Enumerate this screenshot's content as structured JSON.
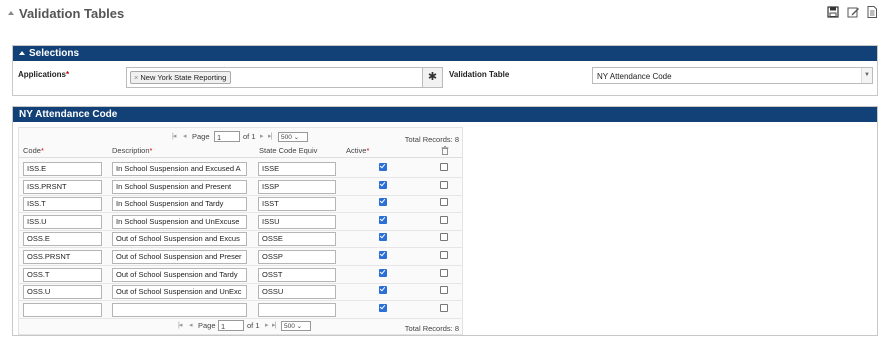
{
  "page": {
    "title": "Validation Tables",
    "icons": [
      "save-icon",
      "edit-icon",
      "document-icon"
    ]
  },
  "selections": {
    "title": "Selections",
    "applications_label": "Applications",
    "applications_value": "New York State Reporting",
    "validation_table_label": "Validation Table",
    "validation_table_value": "NY Attendance Code",
    "required_mark": "*"
  },
  "table_panel": {
    "title": "NY Attendance Code",
    "pager_top": {
      "page_label": "Page",
      "page_value": "1",
      "of_label": "of 1",
      "per_page": "500",
      "total": "Total Records: 8"
    },
    "pager_bottom": {
      "page_label": "Page",
      "page_value": "1",
      "of_label": "of 1",
      "per_page": "500",
      "total": "Total Records: 8"
    },
    "columns": [
      "Code",
      "Description",
      "State Code Equiv",
      "Active"
    ],
    "rows": [
      {
        "code": "ISS.E",
        "description": "In School Suspension and Excused A",
        "state": "ISSE",
        "active": true
      },
      {
        "code": "ISS.PRSNT",
        "description": "In School Suspension and Present",
        "state": "ISSP",
        "active": true
      },
      {
        "code": "ISS.T",
        "description": "In School Suspension and Tardy",
        "state": "ISST",
        "active": true
      },
      {
        "code": "ISS.U",
        "description": "In School Suspension and UnExcuse",
        "state": "ISSU",
        "active": true
      },
      {
        "code": "OSS.E",
        "description": "Out of School Suspension and Excus",
        "state": "OSSE",
        "active": true
      },
      {
        "code": "OSS.PRSNT",
        "description": "Out of School Suspension and Preser",
        "state": "OSSP",
        "active": true
      },
      {
        "code": "OSS.T",
        "description": "Out of School Suspension and Tardy",
        "state": "OSST",
        "active": true
      },
      {
        "code": "OSS.U",
        "description": "Out of School Suspension and UnExc",
        "state": "OSSU",
        "active": true
      },
      {
        "code": "",
        "description": "",
        "state": "",
        "active": true
      }
    ]
  },
  "colors": {
    "header_bar": "#124178",
    "required": "#cc0000",
    "checkbox": "#2a6fd6"
  }
}
